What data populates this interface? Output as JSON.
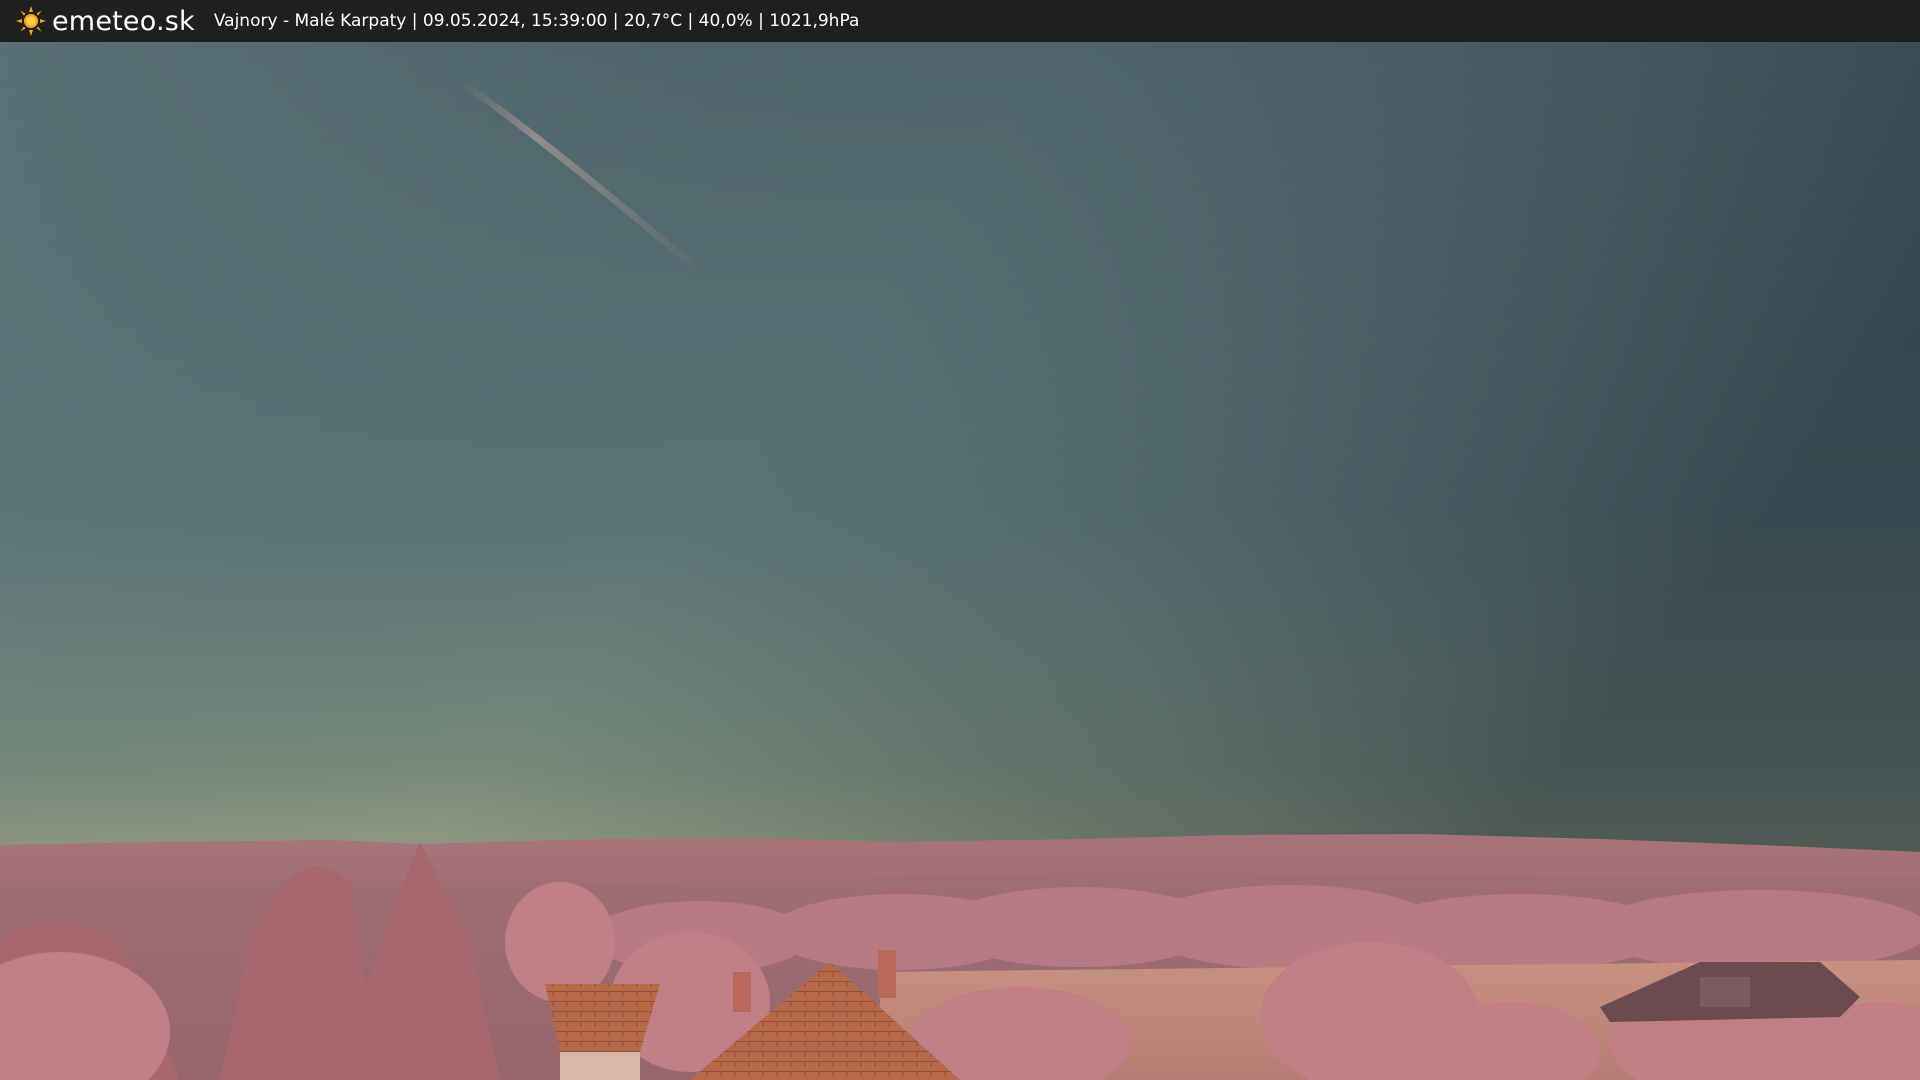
{
  "header": {
    "brand": "emeteo.sk",
    "logo_icon": "sun-icon",
    "info_text": "Vajnory - Malé Karpaty | 09.05.2024, 15:39:00 | 20,7°C | 40,0% | 1021,9hPa"
  },
  "scene": {
    "description_icon": "webcam-landscape",
    "colors": {
      "sky_top_left": "#5a7478",
      "sky_top_right": "#34434d",
      "sky_horizon": "#b9b286",
      "hills": "#a87478",
      "foliage": "#c48288",
      "roof": "#b66a4a",
      "field": "#c89080"
    }
  }
}
